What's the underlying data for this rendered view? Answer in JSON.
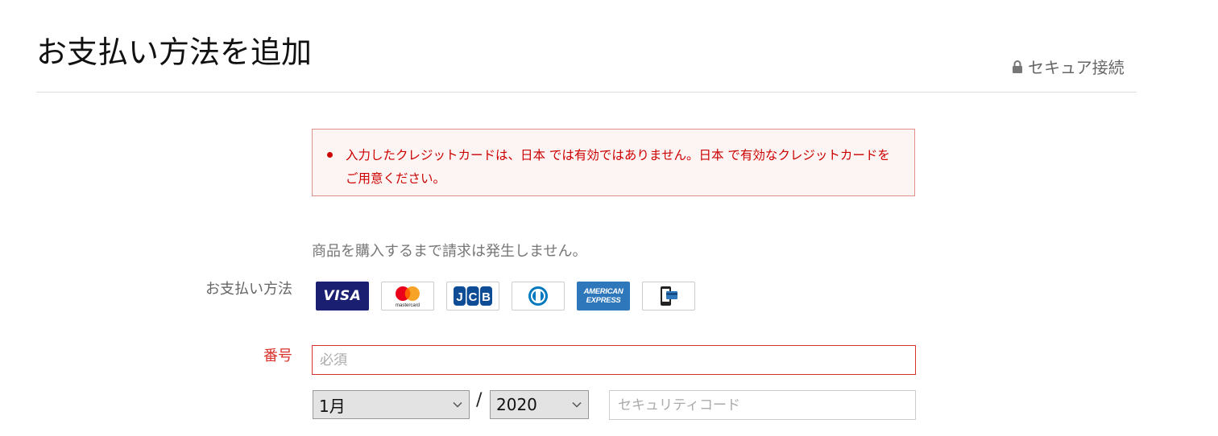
{
  "header": {
    "title": "お支払い方法を追加",
    "secure_label": "セキュア接続"
  },
  "error": {
    "message": "入力したクレジットカードは、日本 では有効ではありません。日本 で有効なクレジットカードをご用意ください。"
  },
  "notice": "商品を購入するまで請求は発生しません。",
  "form": {
    "payment_method_label": "お支払い方法",
    "card_brands": [
      {
        "name": "VISA",
        "icon": "visa-icon"
      },
      {
        "name": "mastercard",
        "icon": "mastercard-icon"
      },
      {
        "name": "JCB",
        "icon": "jcb-icon"
      },
      {
        "name": "Diners Club",
        "icon": "diners-icon"
      },
      {
        "name": "AMERICAN EXPRESS",
        "icon": "amex-icon"
      },
      {
        "name": "mobile payment",
        "icon": "mobile-payment-icon"
      }
    ],
    "amex_line1": "AMERICAN",
    "amex_line2": "EXPRESS",
    "mastercard_text": "mastercard",
    "number_label": "番号",
    "number_placeholder": "必須",
    "number_value": "",
    "month_selected": "1月",
    "year_selected": "2020",
    "separator": "/",
    "security_code_placeholder": "セキュリティコード"
  },
  "colors": {
    "error": "#cc0000",
    "error_border": "#e08d8d",
    "error_bg": "#fdf5f4",
    "visa_blue": "#1a1f71",
    "amex_blue": "#2e77bb",
    "mastercard_red": "#eb001b",
    "mastercard_orange": "#f79e1b"
  }
}
